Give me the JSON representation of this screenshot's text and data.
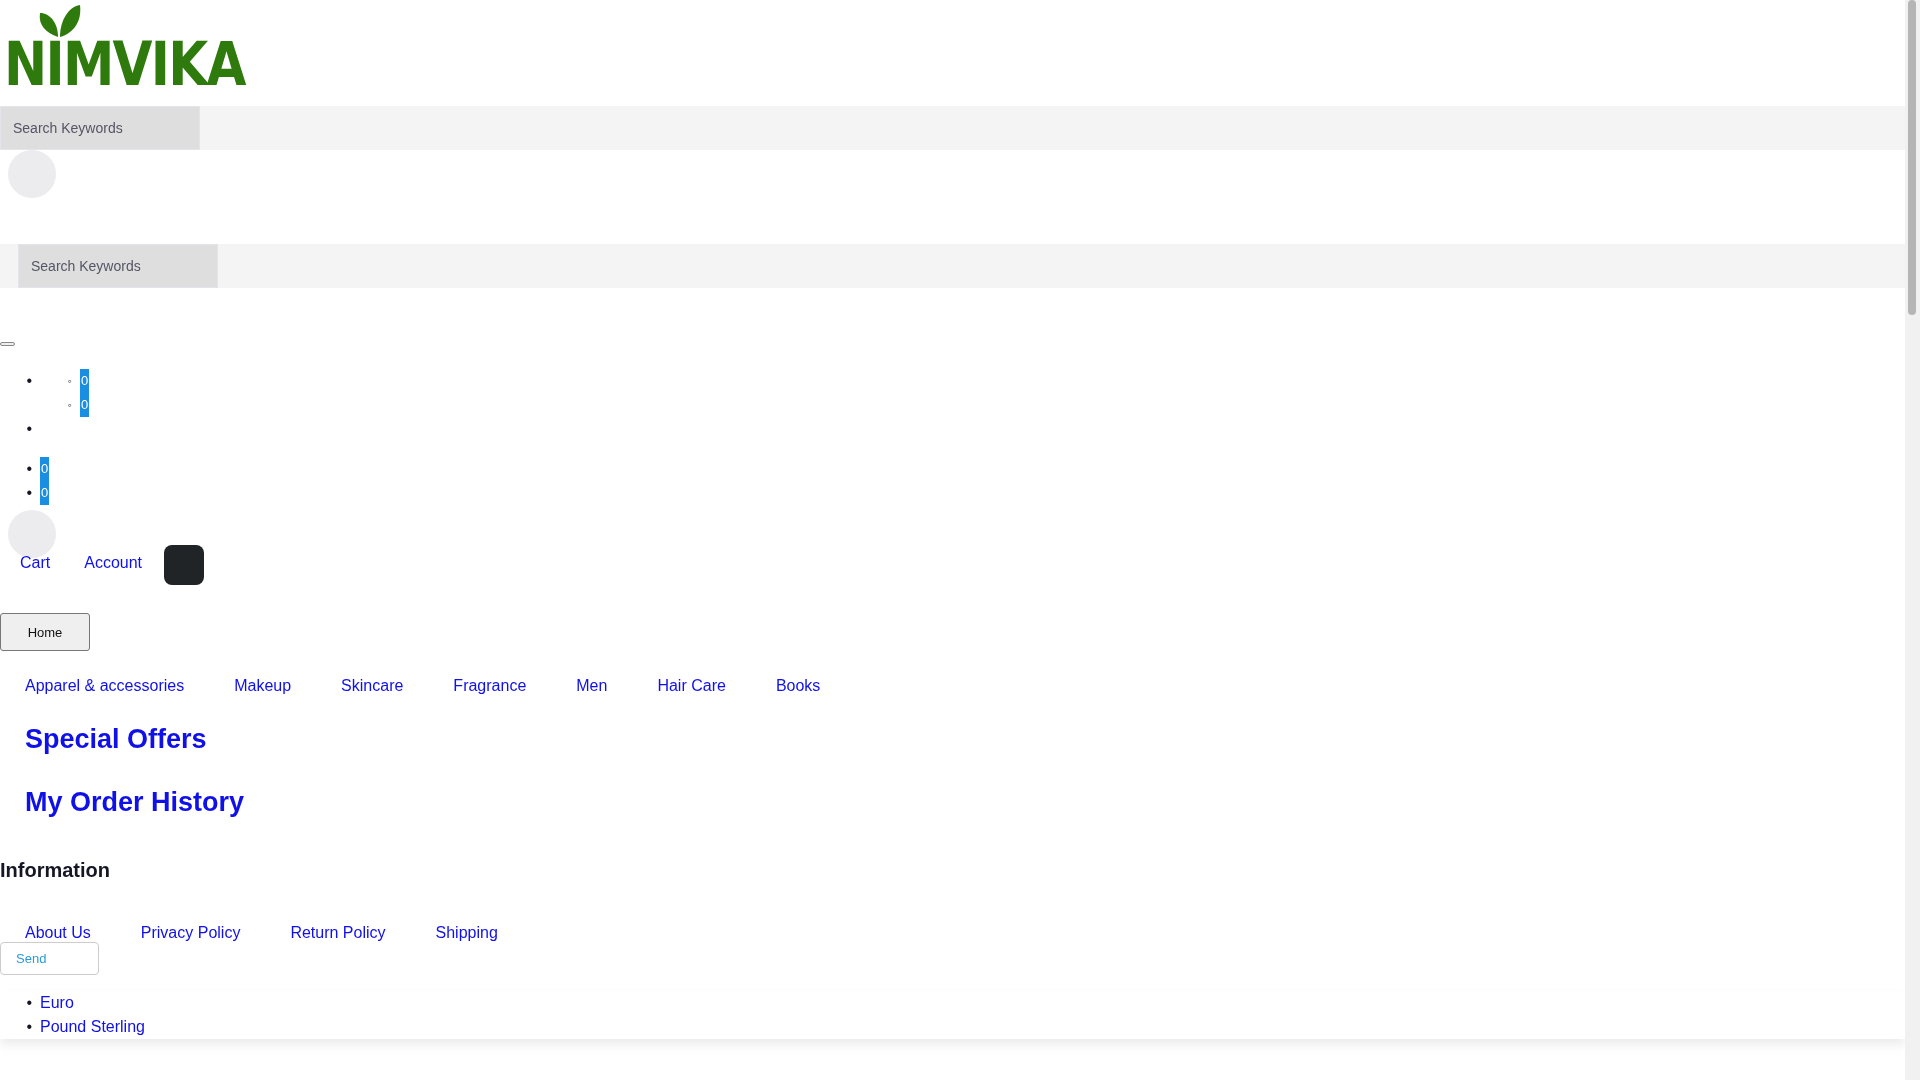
{
  "logo": {
    "text": "NIMVIKA"
  },
  "search_fields": [
    {
      "placeholder": "Search Keywords"
    },
    {
      "placeholder": "Search Keywords"
    }
  ],
  "outline": [
    {
      "marker": "•",
      "children": [
        {
          "marker": "◦",
          "count": "0"
        },
        {
          "marker": "◦",
          "count": "0"
        }
      ]
    },
    {
      "marker": "•"
    }
  ],
  "counts": [
    {
      "marker": "•",
      "count": "0"
    },
    {
      "marker": "•",
      "count": "0"
    }
  ],
  "header_links": [
    "Cart",
    "Account"
  ],
  "home_button": "Home",
  "categories": [
    "Apparel & accessories",
    "Makeup",
    "Skincare",
    "Fragrance",
    "Men",
    "Hair Care",
    "Books"
  ],
  "featured_links": [
    "Special Offers",
    "My Order History"
  ],
  "information": {
    "heading": "Information",
    "links": [
      "About Us",
      "Privacy Policy",
      "Return Policy",
      "Shipping"
    ]
  },
  "send_button": "Send",
  "currencies": [
    {
      "marker": "•",
      "name": "Euro"
    },
    {
      "marker": "•",
      "name": "Pound Sterling"
    }
  ]
}
